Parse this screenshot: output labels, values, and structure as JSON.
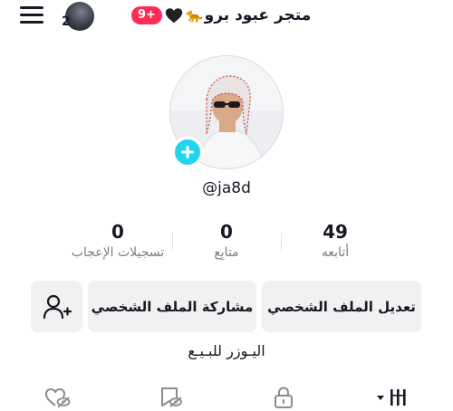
{
  "header": {
    "menu_icon": "hamburger-menu-icon",
    "story_count": "2",
    "notification_badge": "9+",
    "title": "متجر عبود برو",
    "title_emoji_1": "🐆"
  },
  "profile": {
    "username": "@ja8d",
    "add_avatar_icon": "plus-icon"
  },
  "stats": [
    {
      "value": "49",
      "label": "أتابعه"
    },
    {
      "value": "0",
      "label": "متابِع"
    },
    {
      "value": "0",
      "label": "تسجيلات الإعجاب"
    }
  ],
  "actions": {
    "edit_profile": "تعديل الملف الشخصي",
    "share_profile": "مشاركة الملف الشخصي",
    "add_friend_icon": "add-user-icon"
  },
  "bio": "اليـوزر للبـيـع",
  "tabs": [
    {
      "icon": "videos-grid-icon"
    },
    {
      "icon": "lock-icon"
    },
    {
      "icon": "hidden-bookmark-icon"
    },
    {
      "icon": "hidden-heart-icon"
    }
  ],
  "colors": {
    "accent_pink": "#fe2c55",
    "accent_cyan": "#20d5ec",
    "button_gray": "#f1f1f2",
    "text_secondary": "#7b7d85"
  }
}
